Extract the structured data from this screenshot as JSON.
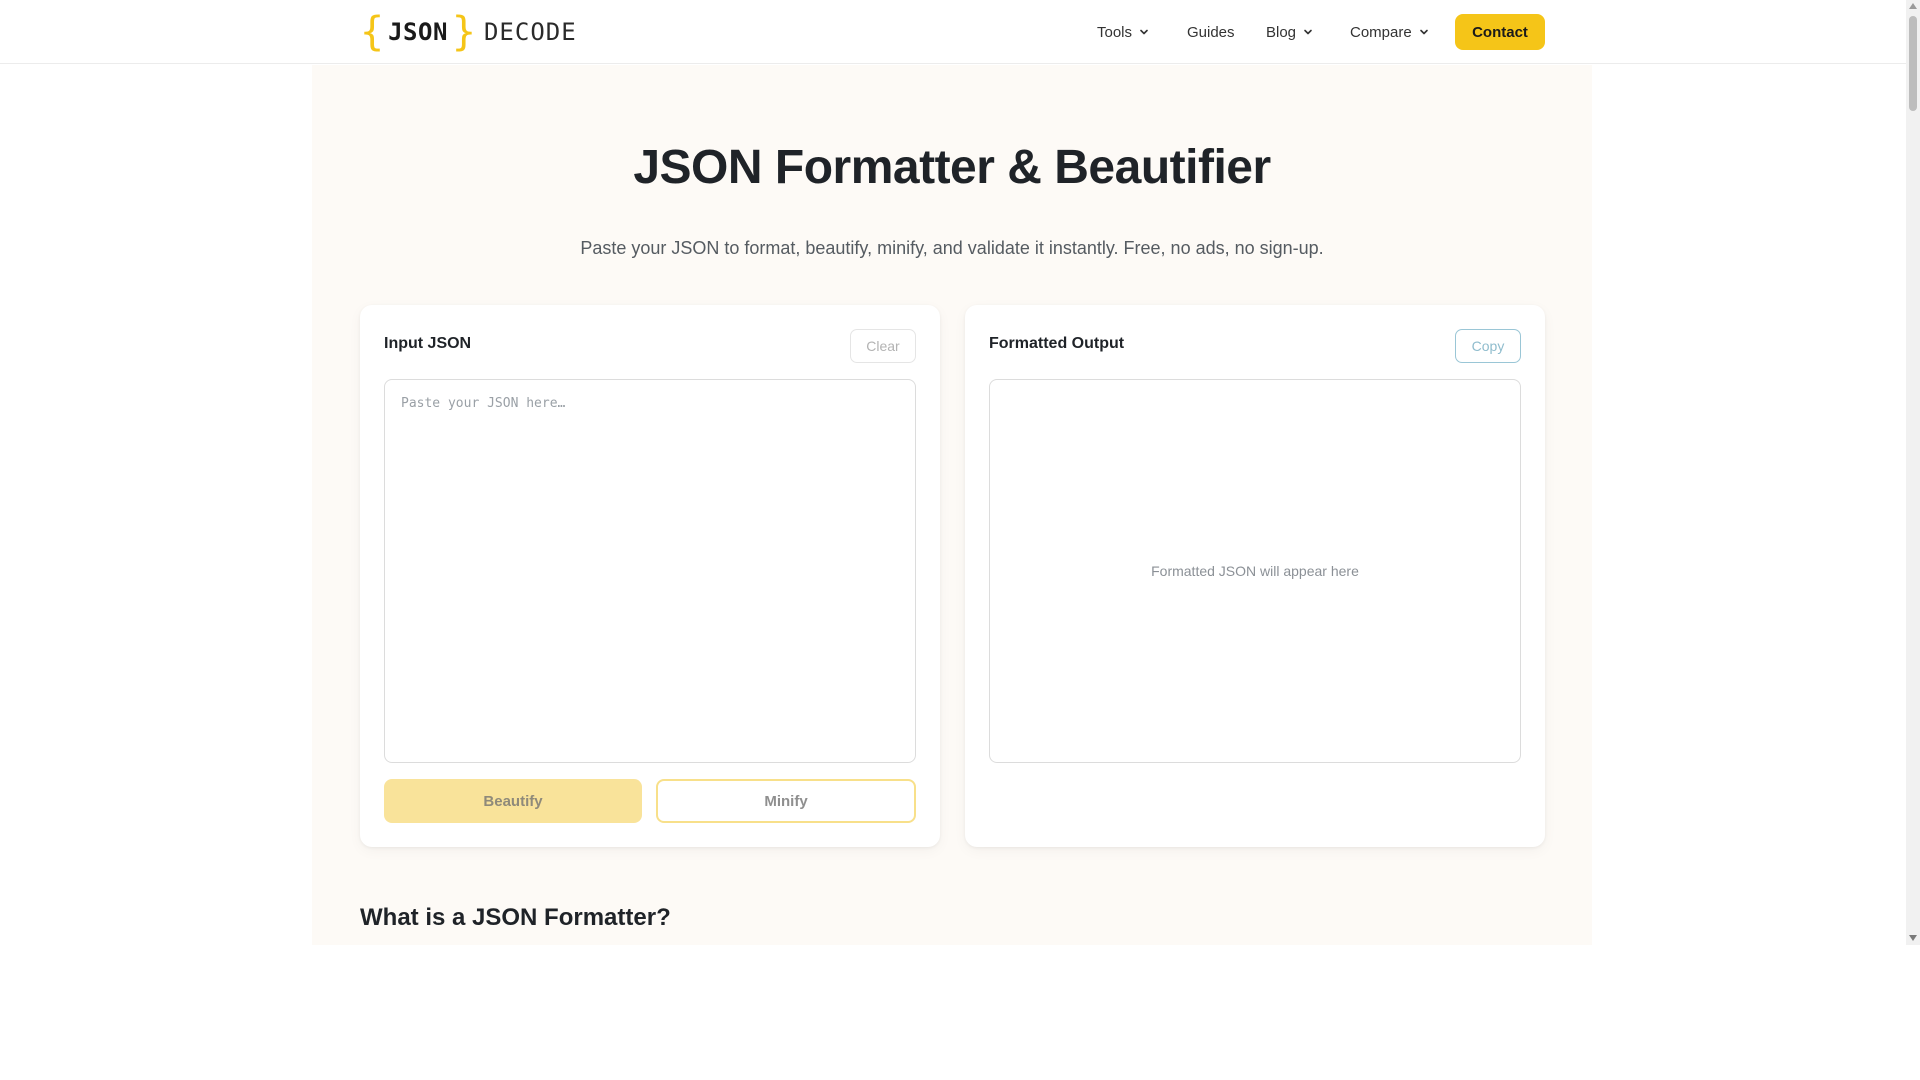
{
  "header": {
    "logo": {
      "bracket_open": "{",
      "json_text": "JSON",
      "bracket_close": "}",
      "decode_text": "DECODE"
    },
    "nav": [
      {
        "label": "Tools",
        "has_dropdown": true
      },
      {
        "label": "Guides",
        "has_dropdown": false
      },
      {
        "label": "Blog",
        "has_dropdown": true
      },
      {
        "label": "Compare",
        "has_dropdown": true
      }
    ],
    "contact_label": "Contact"
  },
  "hero": {
    "title": "JSON Formatter & Beautifier",
    "subtitle": "Paste your JSON to format, beautify, minify, and validate it instantly. Free, no ads, no sign-up."
  },
  "input_panel": {
    "title": "Input JSON",
    "clear_label": "Clear",
    "value": "",
    "placeholder": "Paste your JSON here…",
    "beautify_label": "Beautify",
    "minify_label": "Minify"
  },
  "output_panel": {
    "title": "Formatted Output",
    "copy_label": "Copy",
    "placeholder": "Formatted JSON will appear here"
  },
  "section": {
    "heading": "What is a JSON Formatter?"
  },
  "icons": {
    "dropdown": "chevron-down-icon",
    "scroll_up": "arrow-up-icon",
    "scroll_down": "arrow-down-icon"
  },
  "colors": {
    "accent": "#f5c518",
    "accent_soft": "#f9e39a",
    "page_bg": "#fdfaf6",
    "copy_border": "#9ac6d6"
  }
}
